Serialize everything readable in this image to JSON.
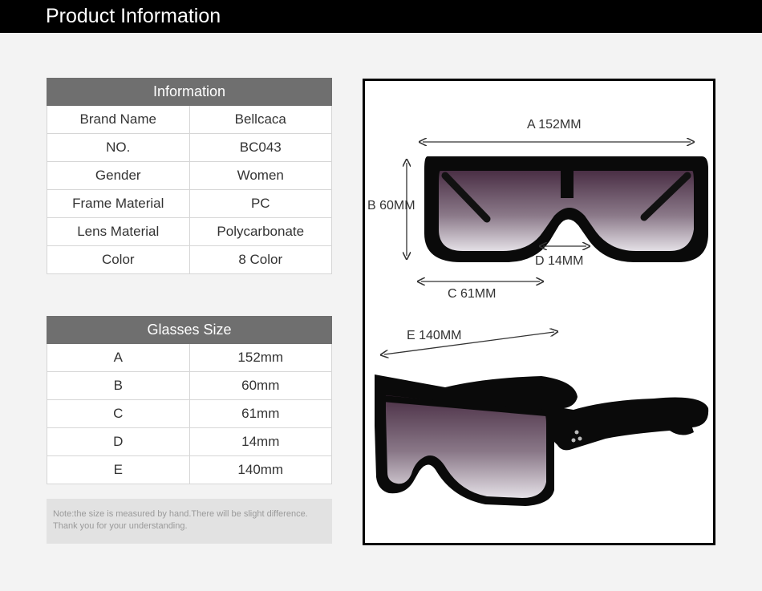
{
  "header": {
    "title": "Product Information"
  },
  "info_table": {
    "title": "Information",
    "rows": [
      {
        "label": "Brand Name",
        "value": "Bellcaca"
      },
      {
        "label": "NO.",
        "value": "BC043"
      },
      {
        "label": "Gender",
        "value": "Women"
      },
      {
        "label": "Frame Material",
        "value": "PC"
      },
      {
        "label": "Lens Material",
        "value": "Polycarbonate"
      },
      {
        "label": "Color",
        "value": "8 Color"
      }
    ]
  },
  "size_table": {
    "title": "Glasses Size",
    "rows": [
      {
        "label": "A",
        "value": "152mm"
      },
      {
        "label": "B",
        "value": "60mm"
      },
      {
        "label": "C",
        "value": "61mm"
      },
      {
        "label": "D",
        "value": "14mm"
      },
      {
        "label": "E",
        "value": "140mm"
      }
    ]
  },
  "note": {
    "line1": "Note:the size is measured by hand.There will be slight difference.",
    "line2": "Thank you for your understanding."
  },
  "diagram": {
    "a": "A 152MM",
    "b": "B 60MM",
    "c": "C 61MM",
    "d": "D 14MM",
    "e": "E 140MM"
  }
}
